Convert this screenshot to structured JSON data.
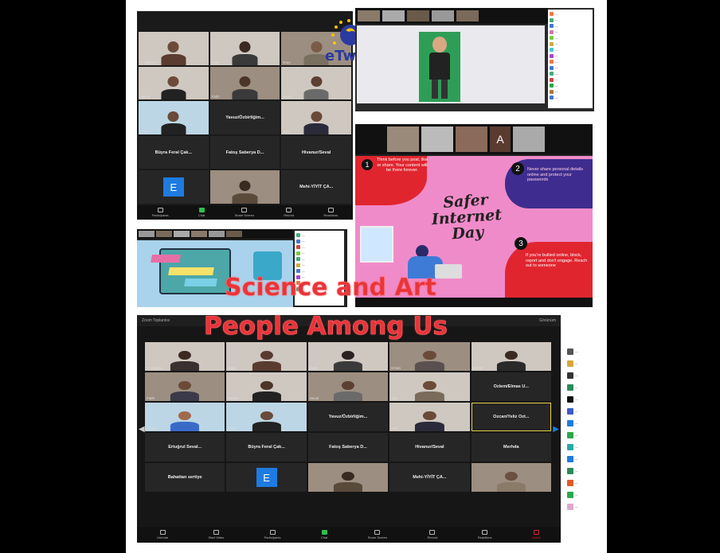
{
  "logo": {
    "text": "eTwinning"
  },
  "overlay": {
    "line1": "Science and Art",
    "line2": "People Among Us"
  },
  "poster": {
    "title": "Safer Internet Day",
    "tip1_number": "1",
    "tip1": "Think before you post, like or share. Your content will be there forever.",
    "tip2_number": "2",
    "tip2": "Never share personal details online and protect your passwords",
    "tip3_number": "3",
    "tip3": "If you're bullied online, block, report and don't engage. Reach out to someone"
  },
  "top_left_panel": {
    "dark_names": [
      "Yavuz/Özbirliğim...",
      "Büyra Feral Çak...",
      "Fatoş Saberya D...",
      "Hivanur/Seval",
      "Mehi-YİYİT ÇA..."
    ],
    "avatar_letter": "E",
    "toolbar": [
      "Unmute",
      "Start Video",
      "Participants",
      "Chat",
      "Share Screen",
      "Record",
      "Reactions"
    ]
  },
  "bottom_panel": {
    "header": "Zoom Toplantısı",
    "view_label": "Görünüm",
    "dark_names": [
      "Ozlem/Elmas U...",
      "Yavuz/Özbirliğim...",
      "Ozcan/Yeliz Ozt...",
      "Ertuğrul Seval...",
      "Büyra Feral Çak...",
      "Fatoş Saberya D...",
      "Hivanur/Seval",
      "Merhda",
      "Bahattan sertiye",
      "Mehi-YİYİT ÇA..."
    ],
    "avatar_letter": "E",
    "toolbar": [
      "Unmute",
      "Start Video",
      "Participants",
      "Chat",
      "Share Screen",
      "Record",
      "Reactions",
      "Leave"
    ]
  },
  "colors": {
    "accent_red": "#e8343a",
    "zoom_green": "#2fbf4a",
    "zoom_blue": "#1e7be0",
    "poster_pink": "#f08bc9",
    "poster_red": "#e0252f"
  }
}
